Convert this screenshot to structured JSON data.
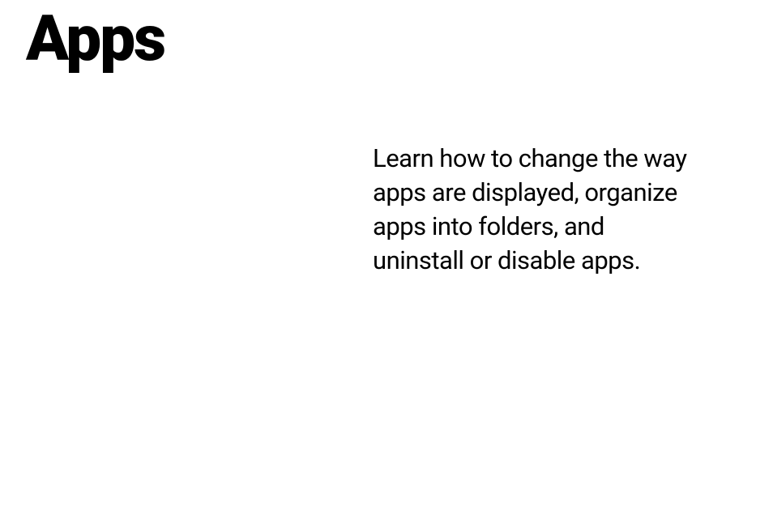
{
  "page": {
    "title": "Apps",
    "description": "Learn how to change the way apps are displayed, organize apps into folders, and uninstall or disable apps."
  }
}
